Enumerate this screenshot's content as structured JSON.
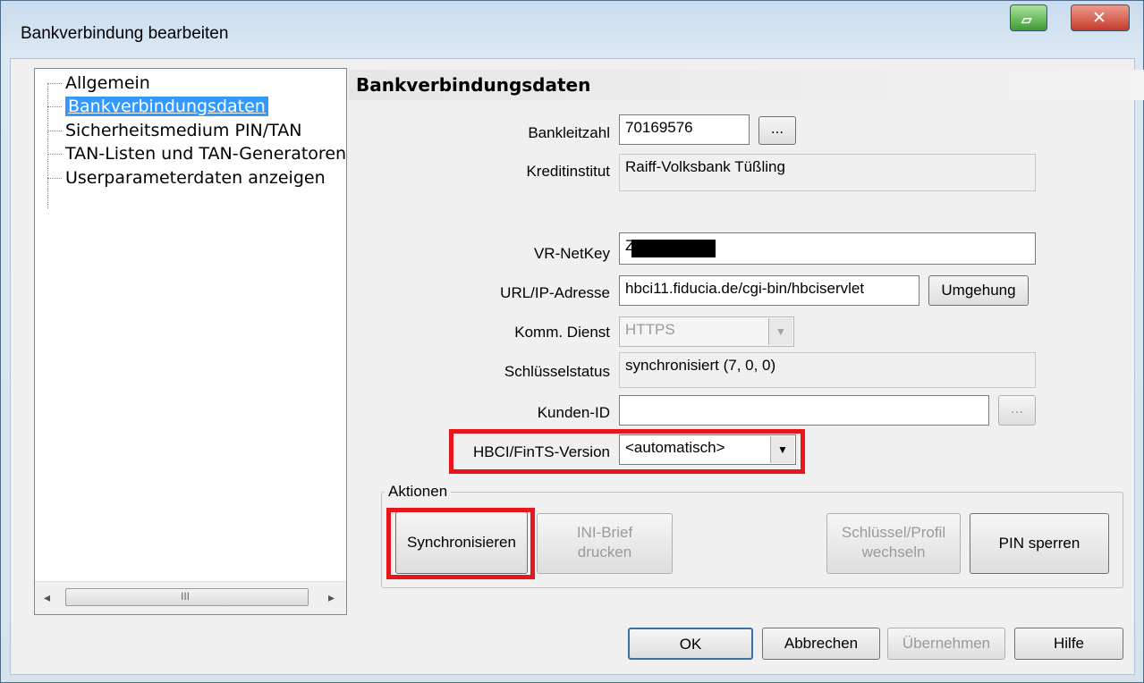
{
  "window": {
    "title": "Bankverbindung bearbeiten"
  },
  "tree": {
    "items": [
      "Allgemein",
      "Bankverbindungsdaten",
      "Sicherheitsmedium PIN/TAN",
      "TAN-Listen und TAN-Generatoren",
      "Userparameterdaten anzeigen"
    ],
    "selected_index": 1,
    "scroll_left": "◂",
    "scroll_right": "▸",
    "scroll_grip": "III"
  },
  "section": {
    "title": "Bankverbindungsdaten"
  },
  "form": {
    "bankleitzahl": {
      "label": "Bankleitzahl",
      "value": "70169576",
      "button": "..."
    },
    "kreditinstitut": {
      "label": "Kreditinstitut",
      "value": "Raiff-Volksbank Tüßling"
    },
    "netkey": {
      "label": "VR-NetKey",
      "value": "Z"
    },
    "url": {
      "label": "URL/IP-Adresse",
      "value": "hbci11.fiducia.de/cgi-bin/hbciservlet",
      "button": "Umgehung"
    },
    "dienst": {
      "label": "Komm. Dienst",
      "value": "HTTPS"
    },
    "schluessel": {
      "label": "Schlüsselstatus",
      "value": "synchronisiert (7, 0, 0)"
    },
    "kunden": {
      "label": "Kunden-ID",
      "value": "",
      "button": "..."
    },
    "version": {
      "label": "HBCI/FinTS-Version",
      "value": "<automatisch>"
    }
  },
  "actions": {
    "group_label": "Aktionen",
    "sync": "Synchronisieren",
    "ini_line1": "INI-Brief",
    "ini_line2": "drucken",
    "key_line1": "Schlüssel/Profil",
    "key_line2": "wechseln",
    "pin": "PIN sperren"
  },
  "footer": {
    "ok": "OK",
    "cancel": "Abbrechen",
    "apply": "Übernehmen",
    "help": "Hilfe"
  },
  "icons": {
    "minimize": "minimize-icon",
    "close": "close-icon",
    "dropdown": "chevron-down-icon"
  },
  "colors": {
    "highlight": "#e8151b",
    "selection": "#3399ff"
  }
}
